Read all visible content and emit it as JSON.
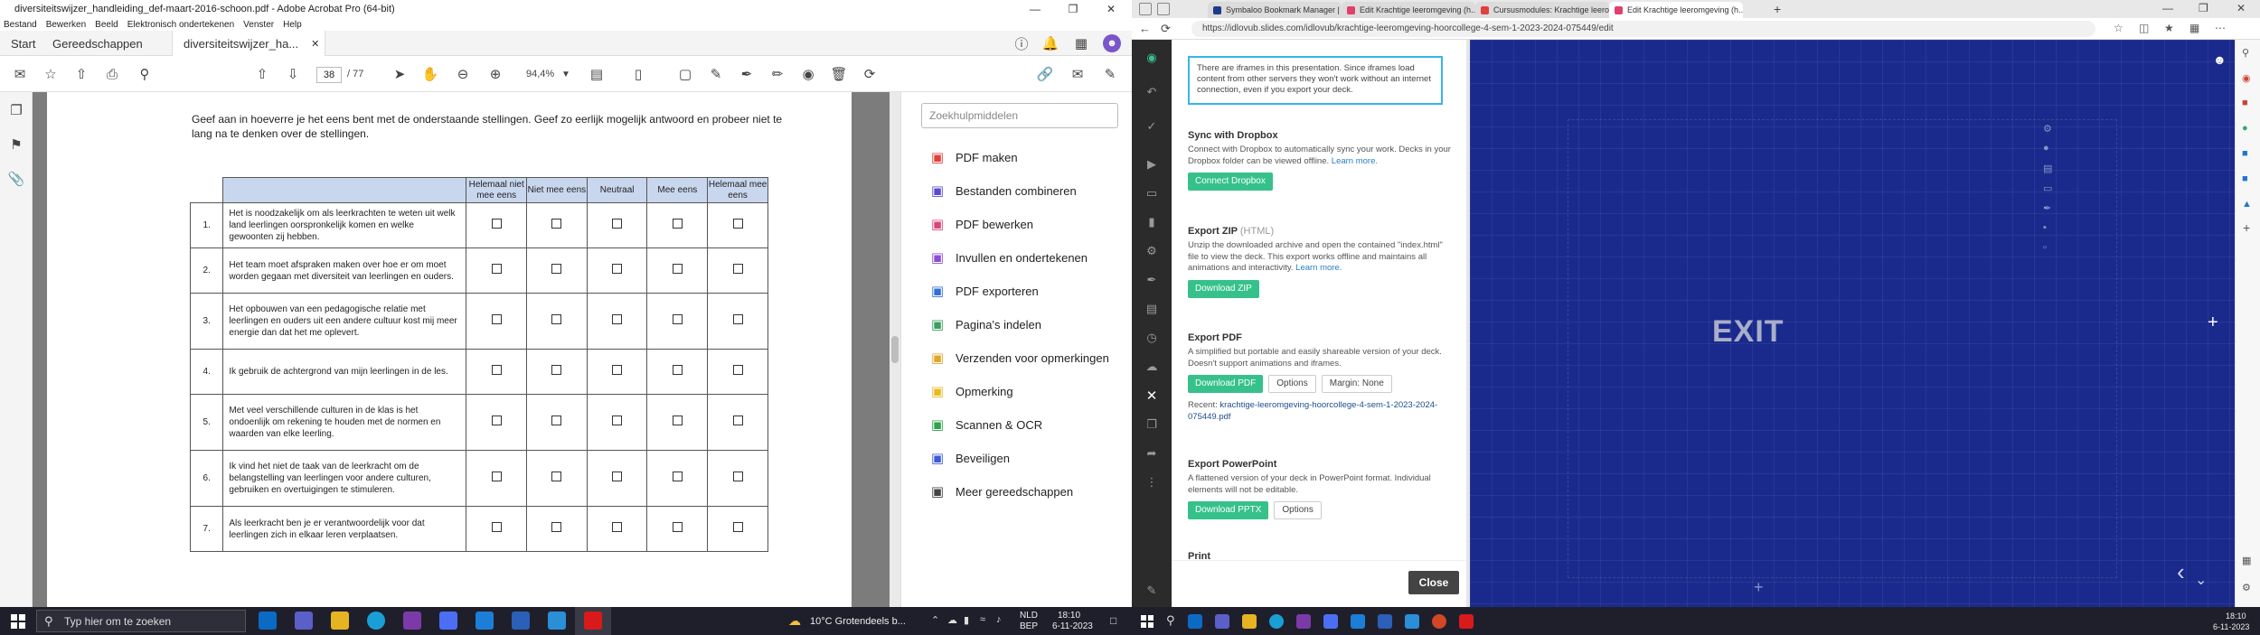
{
  "acrobat": {
    "window_title": "diversiteitswijzer_handleiding_def-maart-2016-schoon.pdf - Adobe Acrobat Pro (64-bit)",
    "menu": [
      "Bestand",
      "Bewerken",
      "Beeld",
      "Elektronisch ondertekenen",
      "Venster",
      "Help"
    ],
    "tabs": [
      "Start",
      "Gereedschappen",
      "diversiteitswijzer_ha..."
    ],
    "page_current": "38",
    "page_total": "/ 77",
    "zoom": "94,4%",
    "intro": "Geef aan in hoeverre je het eens bent met de onderstaande stellingen. Geef zo eerlijk mogelijk antwoord en probeer niet te lang na te denken over de stellingen.",
    "columns": [
      "Helemaal niet mee eens",
      "Niet mee eens",
      "Neutraal",
      "Mee eens",
      "Helemaal mee eens"
    ],
    "rows": [
      {
        "num": "1.",
        "text": "Het is noodzakelijk om als leerkrachten te weten uit welk land leerlingen oorspronkelijk komen en welke gewoonten zij hebben."
      },
      {
        "num": "2.",
        "text": "Het team moet afspraken maken over hoe er om moet worden gegaan met diversiteit van leerlingen en ouders."
      },
      {
        "num": "3.",
        "text": "Het opbouwen van een pedagogische relatie met leerlingen en ouders uit een andere cultuur kost mij meer energie dan dat het me oplevert."
      },
      {
        "num": "4.",
        "text": "Ik gebruik de achtergrond van mijn leerlingen in de les."
      },
      {
        "num": "5.",
        "text": "Met veel verschillende culturen in de klas is het ondoenlijk om rekening te houden met de normen en waarden van elke leerling."
      },
      {
        "num": "6.",
        "text": "Ik vind het niet de taak van de leerkracht om de belangstelling van leerlingen voor andere culturen, gebruiken en overtuigingen te stimuleren."
      },
      {
        "num": "7.",
        "text": "Als leerkracht ben je er verantwoordelijk voor dat leerlingen zich in elkaar leren verplaatsen."
      }
    ],
    "tools_search_placeholder": "Zoekhulpmiddelen",
    "tools": [
      {
        "label": "PDF maken",
        "icon": "create-pdf-icon",
        "color": "#e0403a"
      },
      {
        "label": "Bestanden combineren",
        "icon": "combine-files-icon",
        "color": "#5a4bd1"
      },
      {
        "label": "PDF bewerken",
        "icon": "edit-pdf-icon",
        "color": "#d9467a"
      },
      {
        "label": "Invullen en ondertekenen",
        "icon": "fill-sign-icon",
        "color": "#8a4fd1"
      },
      {
        "label": "PDF exporteren",
        "icon": "export-pdf-icon",
        "color": "#2f6fd6"
      },
      {
        "label": "Pagina's indelen",
        "icon": "organize-pages-icon",
        "color": "#38a05c"
      },
      {
        "label": "Verzenden voor opmerkingen",
        "icon": "send-comments-icon",
        "color": "#e0a72a"
      },
      {
        "label": "Opmerking",
        "icon": "comment-icon",
        "color": "#e8b923"
      },
      {
        "label": "Scannen & OCR",
        "icon": "scan-ocr-icon",
        "color": "#2fa24a"
      },
      {
        "label": "Beveiligen",
        "icon": "protect-icon",
        "color": "#3e5ad6"
      },
      {
        "label": "Meer gereedschappen",
        "icon": "more-tools-icon",
        "color": "#444444"
      }
    ]
  },
  "browser": {
    "tabs": [
      {
        "label": "Symbaloo Bookmark Manager |",
        "color": "#1e3a8a"
      },
      {
        "label": "Edit Krachtige leeromgeving (h...",
        "color": "#e0406a"
      },
      {
        "label": "Cursusmodules: Krachtige leerom...",
        "color": "#e04040"
      },
      {
        "label": "Edit Krachtige leeromgeving (h...",
        "color": "#e0406a"
      }
    ],
    "url": "https://idlovub.slides.com/idlovub/krachtige-leeromgeving-hoorcollege-4-sem-1-2023-2024-075449/edit",
    "note": "There are iframes in this presentation. Since iframes load content from other servers they won't work without an internet connection, even if you export your deck.",
    "dropbox": {
      "title": "Sync with Dropbox",
      "desc": "Connect with Dropbox to automatically sync your work. Decks in your Dropbox folder can be viewed offline.",
      "link": "Learn more.",
      "button": "Connect Dropbox"
    },
    "zip": {
      "title": "Export ZIP",
      "soft": "(HTML)",
      "desc": "Unzip the downloaded archive and open the contained \"index.html\" file to view the deck. This export works offline and maintains all animations and interactivity.",
      "link": "Learn more.",
      "button": "Download ZIP"
    },
    "pdf": {
      "title": "Export PDF",
      "desc": "A simplified but portable and easily shareable version of your deck. Doesn't support animations and iframes.",
      "button": "Download PDF",
      "options": "Options",
      "margin": "Margin: None",
      "recent_label": "Recent:",
      "recent_file": "krachtige-leeromgeving-hoorcollege-4-sem-1-2023-2024-075449.pdf"
    },
    "pptx": {
      "title": "Export PowerPoint",
      "desc": "A flattened version of your deck in PowerPoint format. Individual elements will not be editable.",
      "button": "Download PPTX",
      "options": "Options"
    },
    "print_title": "Print",
    "close": "Close",
    "slide_text": "EXIT"
  },
  "taskbar": {
    "search_placeholder": "Typ hier om te zoeken",
    "weather": "10°C  Grotendeels b...",
    "lang_top": "NLD",
    "lang_bottom": "BEP",
    "time": "18:10",
    "date": "6-11-2023",
    "time_right": "18:10",
    "date_right": "6-11-2023"
  }
}
